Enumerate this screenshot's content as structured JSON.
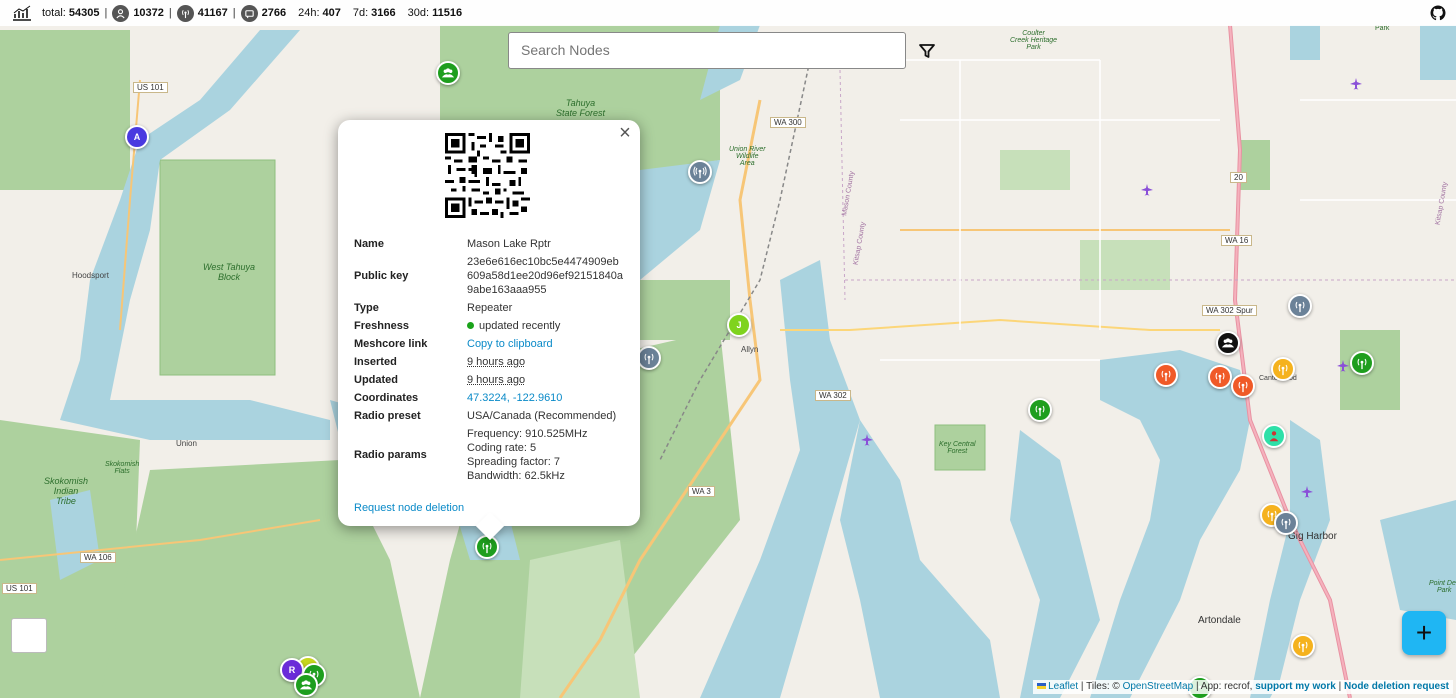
{
  "stats": {
    "total_label": "total:",
    "total": "54305",
    "companions": "10372",
    "repeaters": "41167",
    "room_servers": "2766",
    "h24_label": "24h:",
    "h24": "407",
    "d7_label": "7d:",
    "d7": "3166",
    "d30_label": "30d:",
    "d30": "11516",
    "sep": "|"
  },
  "search": {
    "placeholder": "Search Nodes"
  },
  "popup": {
    "close": "×",
    "rows": {
      "name_key": "Name",
      "name_val": "Mason Lake Rptr",
      "pubkey_key": "Public key",
      "pubkey_val": "23e6e616ec10bc5e4474909eb609a58d1ee20d96ef92151840a9abe163aaa955",
      "type_key": "Type",
      "type_val": "Repeater",
      "fresh_key": "Freshness",
      "fresh_val": "updated recently",
      "link_key": "Meshcore link",
      "link_val": "Copy to clipboard",
      "ins_key": "Inserted",
      "ins_val": "9 hours ago",
      "upd_key": "Updated",
      "upd_val": "9 hours ago",
      "coord_key": "Coordinates",
      "coord_val": "47.3224, -122.9610",
      "preset_key": "Radio preset",
      "preset_val": "USA/Canada (Recommended)",
      "params_key": "Radio params",
      "freq": "Frequency: 910.525MHz",
      "coding": "Coding rate: 5",
      "sf": "Spreading factor: 7",
      "bw": "Bandwidth: 62.5kHz"
    },
    "delete_link": "Request node deletion"
  },
  "fab": {
    "label": "+"
  },
  "attribution": {
    "leaflet": "Leaflet",
    "tiles": " | Tiles: © ",
    "osm": "OpenStreetMap",
    "app": " | App: recrof, ",
    "support": "support my work",
    "sep": " | ",
    "deletion": "Node deletion request"
  },
  "map_labels": {
    "tahuya_forest": "Tahuya\nState Forest",
    "west_tahuya": "West Tahuya\nBlock",
    "hoodsport": "Hoodsport",
    "union": "Union",
    "skokomish_flats": "Skokomish\nFlats",
    "skokomish_tribe": "Skokomish\nIndian\nTribe",
    "union_river": "Union River\nWildlife\nArea",
    "allyn": "Allyn",
    "key_central": "Key Central\nForest",
    "gig_harbor": "Gig Harbor",
    "artondale": "Artondale",
    "coulter": "Coulter\nCreek Heritage\nPark",
    "canterwood": "Canterwood",
    "point_defiance": "Point Defi\nPark",
    "mason_county": "Mason County",
    "kitsap_county": "Kitsap County",
    "kitsap_county2": "Kitsap County",
    "park": "Park"
  },
  "shields": {
    "us101": "US 101",
    "wa300": "WA 300",
    "wa16": "WA 16",
    "wa302spur": "WA 302 Spur",
    "wa302": "WA 302",
    "wa3": "WA 3",
    "wa106": "WA 106",
    "us101b": "US 101",
    "r20": "20"
  },
  "markers": {
    "a": "A",
    "j": "J",
    "r": "R"
  },
  "colors": {
    "water": "#aad3df",
    "forest": "#add19e",
    "land": "#f2efe9",
    "repeater_green": "#1e9e1e",
    "repeater_gray": "#6b8298",
    "accent": "#1fb6f3"
  }
}
